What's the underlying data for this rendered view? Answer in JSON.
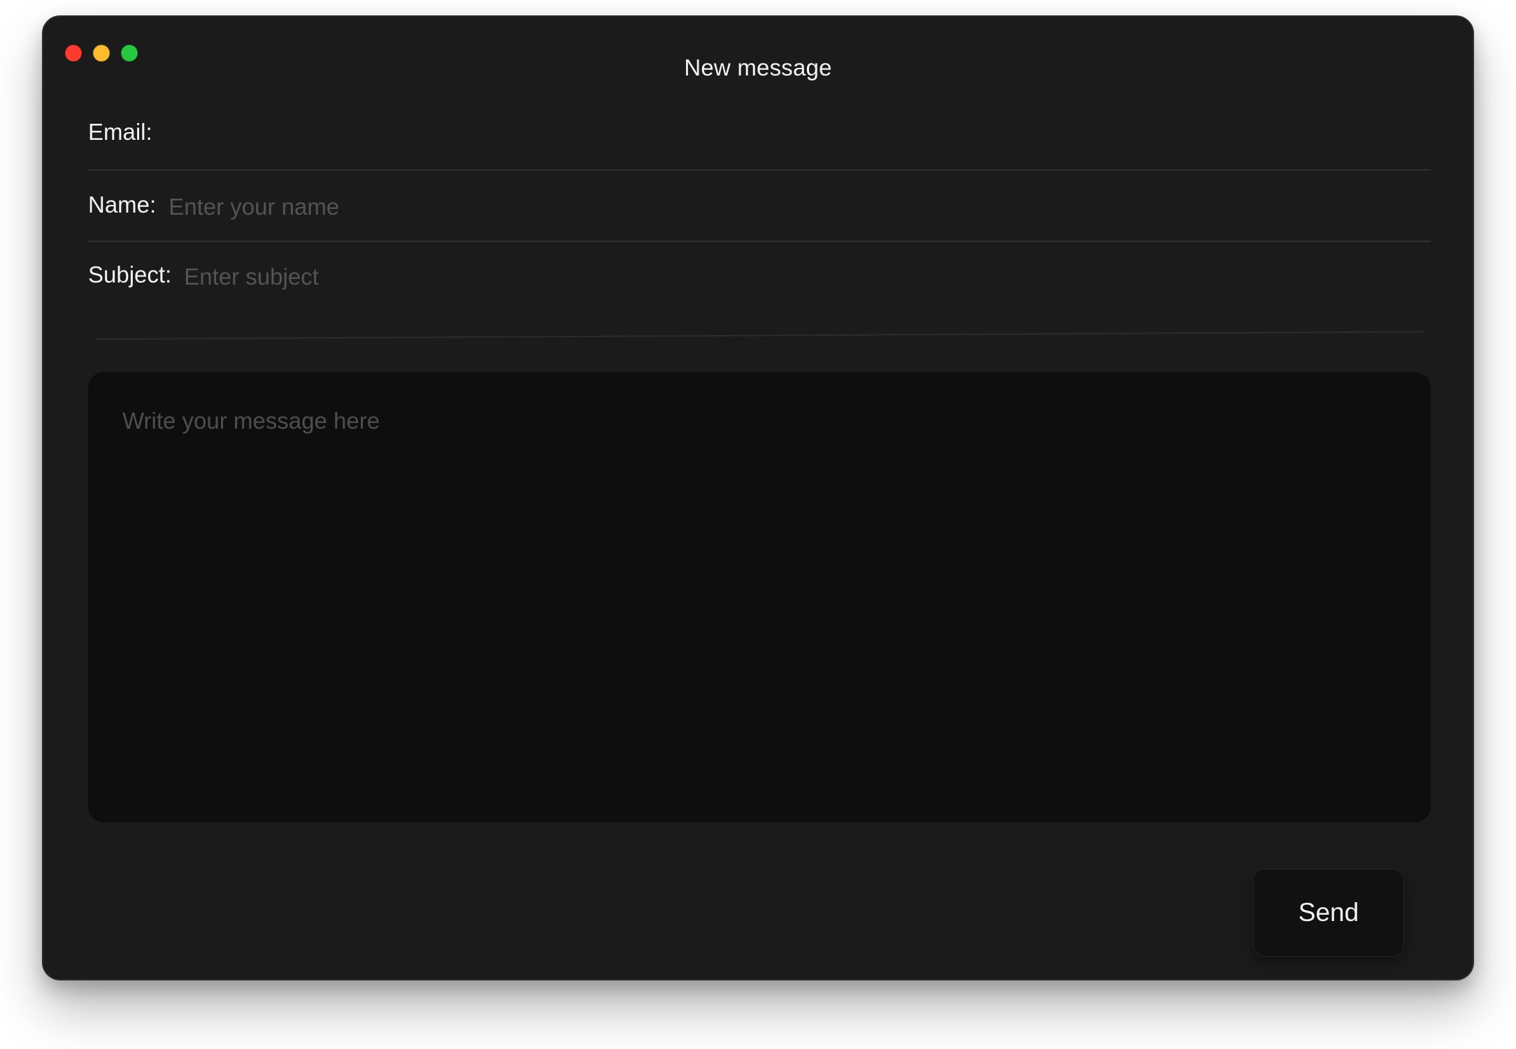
{
  "window": {
    "title": "New message",
    "controls": {
      "close": "close-window",
      "minimize": "minimize-window",
      "zoom": "zoom-window"
    },
    "colors": {
      "close": "#ff3b30",
      "minimize": "#febc2e",
      "zoom": "#28c840"
    }
  },
  "form": {
    "email": {
      "label": "Email:",
      "value": "",
      "placeholder": ""
    },
    "name": {
      "label": "Name:",
      "value": "",
      "placeholder": "Enter your name"
    },
    "subject": {
      "label": "Subject:",
      "value": "",
      "placeholder": "Enter subject"
    },
    "message": {
      "value": "",
      "placeholder": "Write your message here"
    }
  },
  "actions": {
    "send_label": "Send"
  }
}
